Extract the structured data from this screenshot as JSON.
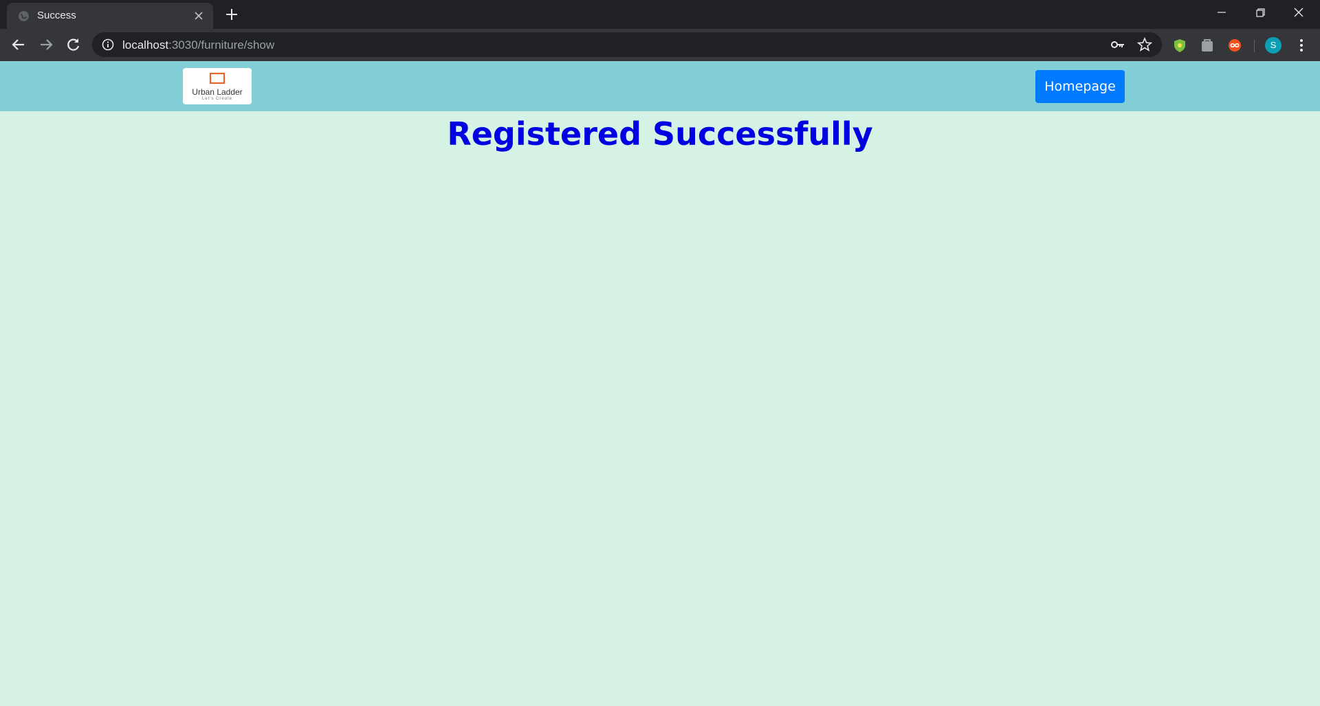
{
  "browser": {
    "tab_title": "Success",
    "url_host": "localhost",
    "url_path": ":3030/furniture/show",
    "profile_initial": "S"
  },
  "page": {
    "logo": {
      "brand": "Urban Ladder",
      "tagline": "Let's Create"
    },
    "homepage_button": "Homepage",
    "heading": "Registered Successfully"
  },
  "colors": {
    "navbar": "#82cfd8",
    "background": "#d6f2e5",
    "button": "#007bff",
    "heading": "#0000e0"
  }
}
